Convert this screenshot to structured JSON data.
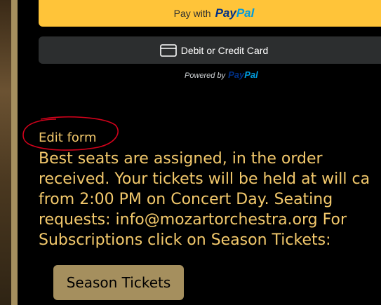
{
  "paypal": {
    "pay_with": "Pay with",
    "logo_pay": "Pay",
    "logo_pal": "Pal",
    "card_label": "Debit or Credit Card",
    "powered_by": "Powered by"
  },
  "form": {
    "edit_link": "Edit form"
  },
  "notice": {
    "lines": [
      "Best seats are assigned, in the order",
      "received. Your tickets will be held at will ca",
      "from 2:00 PM on Concert Day. Seating",
      "requests: info@mozartorchestra.org For",
      "Subscriptions click on Season Tickets:"
    ]
  },
  "season_button": {
    "label": "Season Tickets"
  },
  "colors": {
    "paypal_yellow": "#ffc439",
    "paypal_dark_blue": "#003087",
    "paypal_light_blue": "#009cde",
    "card_button": "#2c2e2f",
    "text_gold": "#f3c96c",
    "button_tan": "#a58f5e",
    "annotation_red": "#d0021b"
  },
  "icons": {
    "card": "credit-card-icon"
  }
}
